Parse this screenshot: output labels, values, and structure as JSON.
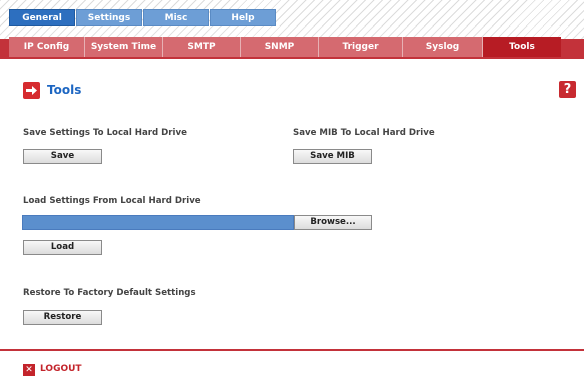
{
  "top_tabs": [
    {
      "label": "General",
      "active": true
    },
    {
      "label": "Settings",
      "active": false
    },
    {
      "label": "Misc",
      "active": false
    },
    {
      "label": "Help",
      "active": false
    }
  ],
  "sub_tabs": [
    {
      "label": "IP Config",
      "active": false
    },
    {
      "label": "System Time",
      "active": false
    },
    {
      "label": "SMTP",
      "active": false
    },
    {
      "label": "SNMP",
      "active": false
    },
    {
      "label": "Trigger",
      "active": false
    },
    {
      "label": "Syslog",
      "active": false
    },
    {
      "label": "Tools",
      "active": true
    }
  ],
  "page": {
    "title": "Tools",
    "help_glyph": "?",
    "title_icon": "arrow-right-icon"
  },
  "sections": {
    "save": {
      "label": "Save Settings To Local Hard Drive",
      "button": "Save"
    },
    "save_mib": {
      "label": "Save MIB To Local Hard Drive",
      "button": "Save MIB"
    },
    "load": {
      "label": "Load Settings From Local Hard Drive",
      "browse_button": "Browse...",
      "button": "Load"
    },
    "restore": {
      "label": "Restore To Factory Default Settings",
      "button": "Restore"
    }
  },
  "footer": {
    "logout_label": "LOGOUT",
    "logout_glyph": "✕"
  },
  "colors": {
    "tab_blue": "#2d6fbf",
    "tab_red": "#c3323a",
    "title_blue": "#1d66c2"
  }
}
